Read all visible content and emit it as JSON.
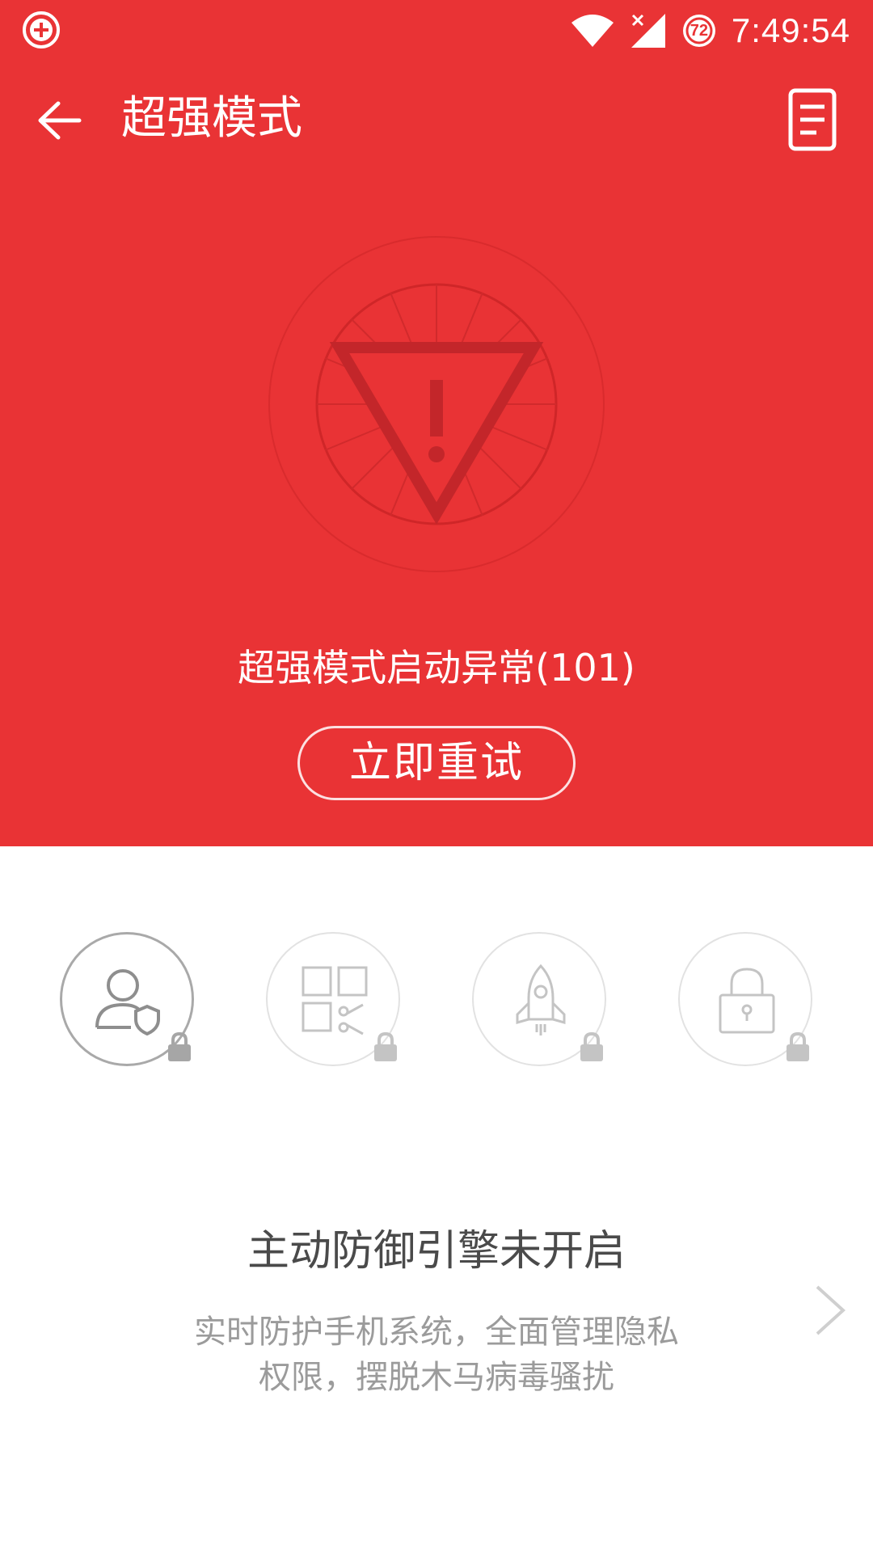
{
  "status_bar": {
    "time": "7:49:54",
    "battery_level": "72"
  },
  "app_bar": {
    "title": "超强模式"
  },
  "hero": {
    "error_message": "超强模式启动异常(101)",
    "retry_label": "立即重试"
  },
  "features": [
    {
      "icon": "user-shield-icon",
      "locked": true,
      "active": true
    },
    {
      "icon": "app-grid-scissors-icon",
      "locked": true,
      "active": false
    },
    {
      "icon": "rocket-icon",
      "locked": true,
      "active": false
    },
    {
      "icon": "padlock-icon",
      "locked": true,
      "active": false
    }
  ],
  "engine": {
    "title": "主动防御引擎未开启",
    "description_line1": "实时防护手机系统，全面管理隐私",
    "description_line2": "权限，摆脱木马病毒骚扰"
  },
  "colors": {
    "accent_red": "#e93335",
    "text_dark": "#4a4a4a",
    "text_gray": "#9b9b9b"
  }
}
